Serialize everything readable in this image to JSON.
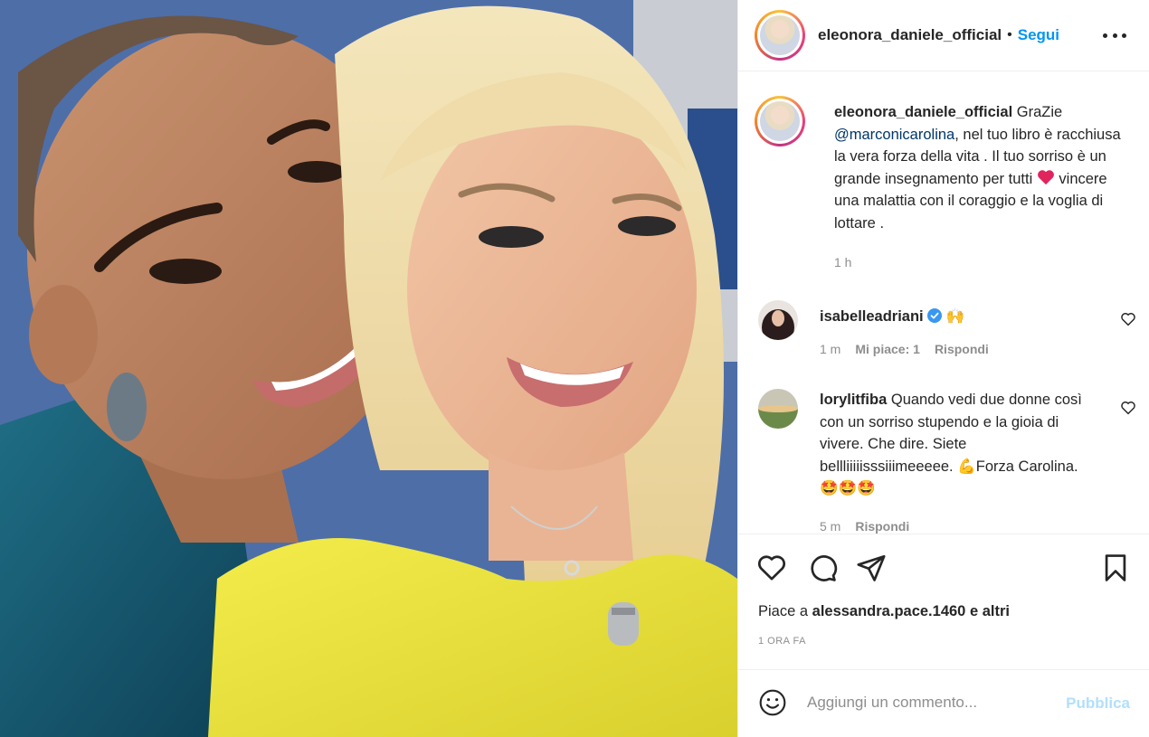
{
  "post": {
    "author": "eleonora_daniele_official",
    "separator": "•",
    "follow_label": "Segui",
    "caption_prefix": "GraZie",
    "caption_mention": "@marconicarolina",
    "caption_text": ", nel tuo libro è racchiusa la vera forza della vita . Il tuo sorriso è un grande insegnamento per tutti",
    "caption_text_end": " vincere una malattia con il coraggio e la voglia di lottare .",
    "caption_time": "1 h"
  },
  "comments": [
    {
      "username": "isabelleadriani",
      "text": "",
      "emoji": "🙌",
      "time": "1 m",
      "likes": "Mi piace: 1",
      "reply_label": "Rispondi"
    },
    {
      "username": "lorylitfiba",
      "text": "Quando vedi due donne così con un sorriso stupendo e la gioia di vivere. Che dire. Siete bellliiiiisssiiimeeeee.",
      "text_mid_emoji": "💪",
      "text_end": "Forza Carolina.",
      "trail_emojis": "🤩🤩🤩",
      "time": "5 m",
      "reply_label": "Rispondi"
    }
  ],
  "actions": {
    "likes_prefix": "Piace a",
    "likes_user": "alessandra.pace.1460",
    "likes_suffix": "e altri",
    "posted_when": "1 ORA FA"
  },
  "add_comment": {
    "placeholder": "Aggiungi un commento...",
    "publish_label": "Pubblica"
  },
  "colors": {
    "link_blue": "#0095f6",
    "mention_blue": "#00376b",
    "muted": "#8e8e8e",
    "publish_disabled": "#b2dffc"
  },
  "icons": [
    "more-options-icon",
    "heart-icon",
    "comment-icon",
    "share-icon",
    "bookmark-icon",
    "emoji-icon",
    "verified-icon",
    "small-heart-icon"
  ]
}
